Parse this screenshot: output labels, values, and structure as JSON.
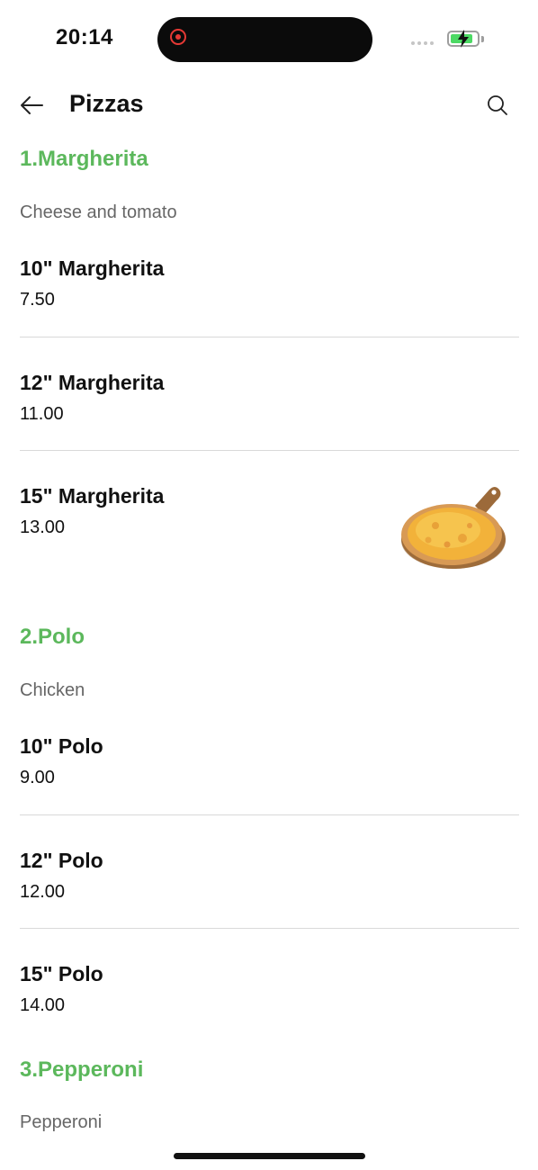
{
  "status": {
    "time": "20:14"
  },
  "header": {
    "title": "Pizzas"
  },
  "categories": [
    {
      "title": "1.Margherita",
      "description": "Cheese and tomato",
      "items": [
        {
          "name": "10\" Margherita",
          "price": "7.50"
        },
        {
          "name": "12\" Margherita",
          "price": "11.00"
        },
        {
          "name": "15\" Margherita",
          "price": "13.00"
        }
      ]
    },
    {
      "title": "2.Polo",
      "description": "Chicken",
      "items": [
        {
          "name": "10\" Polo",
          "price": "9.00"
        },
        {
          "name": "12\" Polo",
          "price": "12.00"
        },
        {
          "name": "15\" Polo",
          "price": "14.00"
        }
      ]
    },
    {
      "title": "3.Pepperoni",
      "description": "Pepperoni",
      "items": []
    }
  ],
  "colors": {
    "accent": "#5cb85c",
    "battery": "#4cd964",
    "recording": "#e53935"
  },
  "icons": [
    "back-arrow-icon",
    "search-icon",
    "recording-icon",
    "battery-charging-icon"
  ]
}
